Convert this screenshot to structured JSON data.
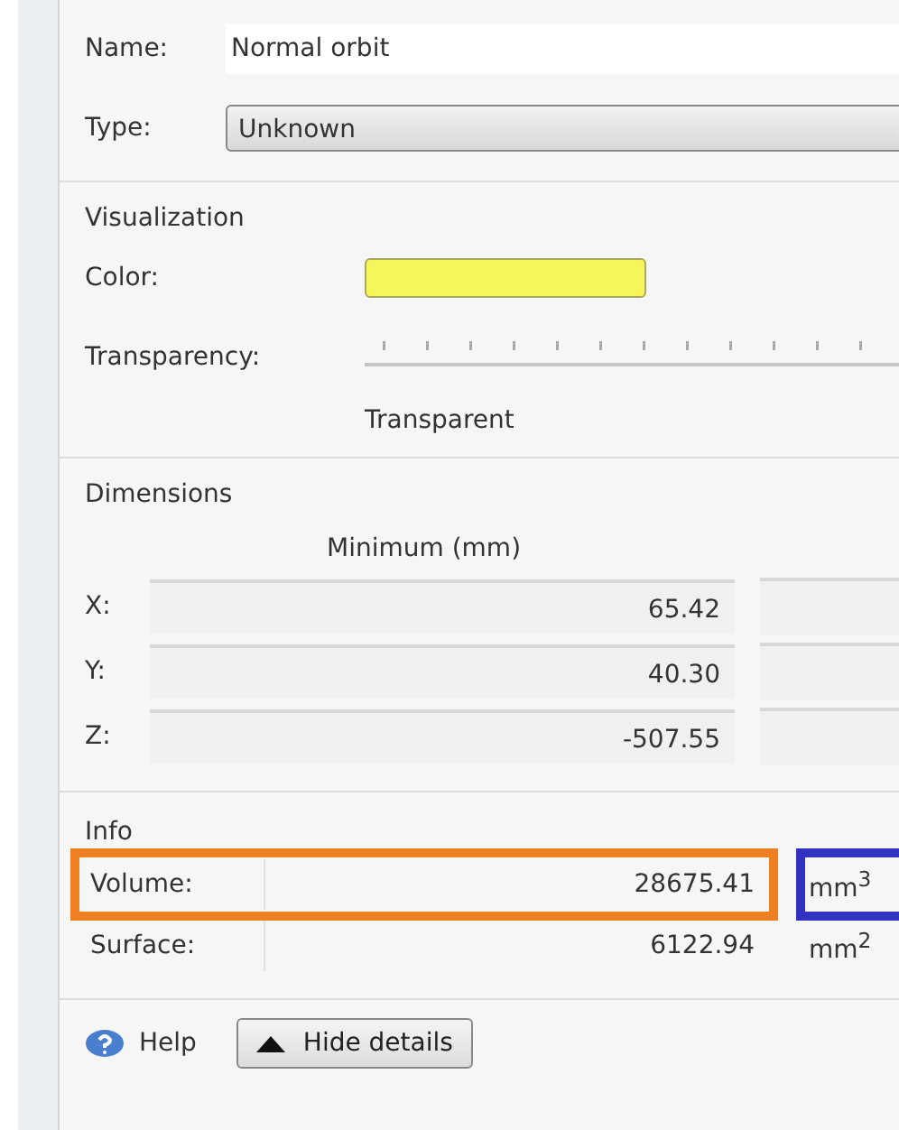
{
  "name": {
    "label": "Name:",
    "value": "Normal orbit"
  },
  "type": {
    "label": "Type:",
    "value": "Unknown"
  },
  "visualization": {
    "title": "Visualization",
    "color_label": "Color:",
    "color": "#f6f65a",
    "transparency_label": "Transparency:",
    "transparency_caption": "Transparent"
  },
  "dimensions": {
    "title": "Dimensions",
    "column_header": "Minimum (mm)",
    "rows": [
      {
        "axis": "X:",
        "minimum": "65.42"
      },
      {
        "axis": "Y:",
        "minimum": "40.30"
      },
      {
        "axis": "Z:",
        "minimum": "-507.55"
      }
    ]
  },
  "info": {
    "title": "Info",
    "rows": [
      {
        "label": "Volume:",
        "value": "28675.41",
        "unit": "mm$^{3}$",
        "value_highlight": true,
        "unit_highlight": true
      },
      {
        "label": "Surface:",
        "value": "6122.94",
        "unit": "mm$^{2}$",
        "value_highlight": false,
        "unit_highlight": false
      }
    ]
  },
  "footer": {
    "help": "Help",
    "toggle": "Hide details",
    "expanded": true
  }
}
